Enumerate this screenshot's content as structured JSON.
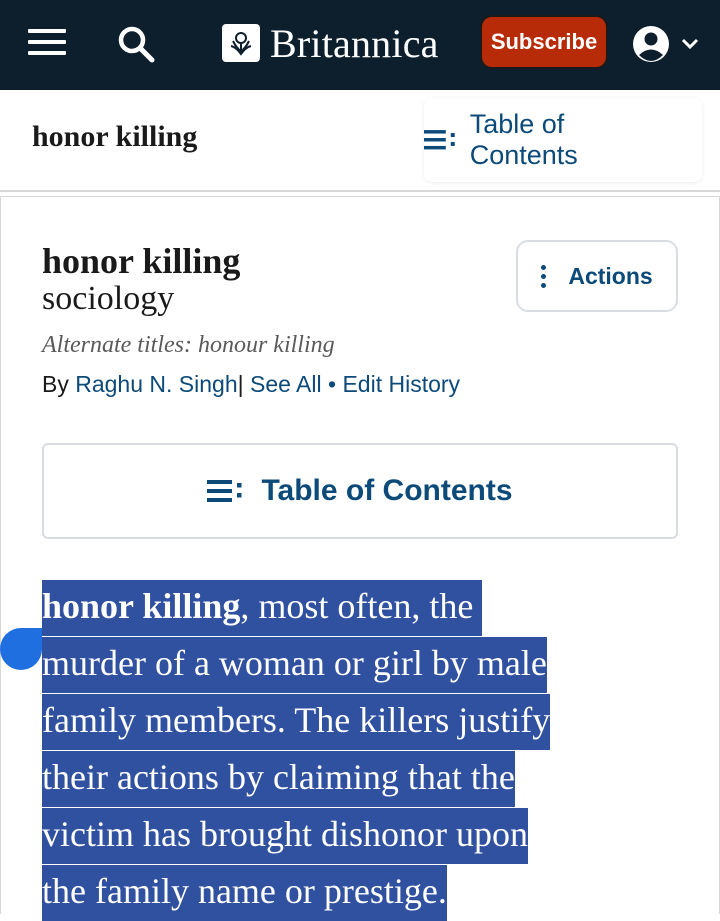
{
  "nav": {
    "brand": "Britannica",
    "subscribe_label": "Subscribe",
    "icons": [
      "menu-icon",
      "search-icon",
      "britannica-logo-icon",
      "account-icon",
      "chevron-down-icon"
    ]
  },
  "sticky": {
    "title": "honor killing",
    "toc_label": "Table of Contents"
  },
  "article": {
    "title": "honor killing",
    "subtitle": "sociology",
    "alternate_titles": "Alternate titles: honour killing",
    "by": "By",
    "author": "Raghu N. Singh",
    "see_all": "See All",
    "bullet": "•",
    "edit_history": "Edit History",
    "actions_label": "Actions",
    "toc_label": "Table of Contents",
    "paragraph": {
      "bold": "honor killing",
      "line1_rest": ", most often, the",
      "line2": "murder of a woman or girl by male",
      "line3": "family members. The killers justify",
      "line4": "their actions by claiming that the",
      "line5": "victim has brought dishonor upon",
      "line6": "the family name or prestige."
    }
  },
  "colors": {
    "nav_bg": "#0d1f2d",
    "subscribe_bg": "#b72b09",
    "link": "#0c4a7a",
    "selection": "#3050a0",
    "selection_handle": "#1f6fe0"
  }
}
